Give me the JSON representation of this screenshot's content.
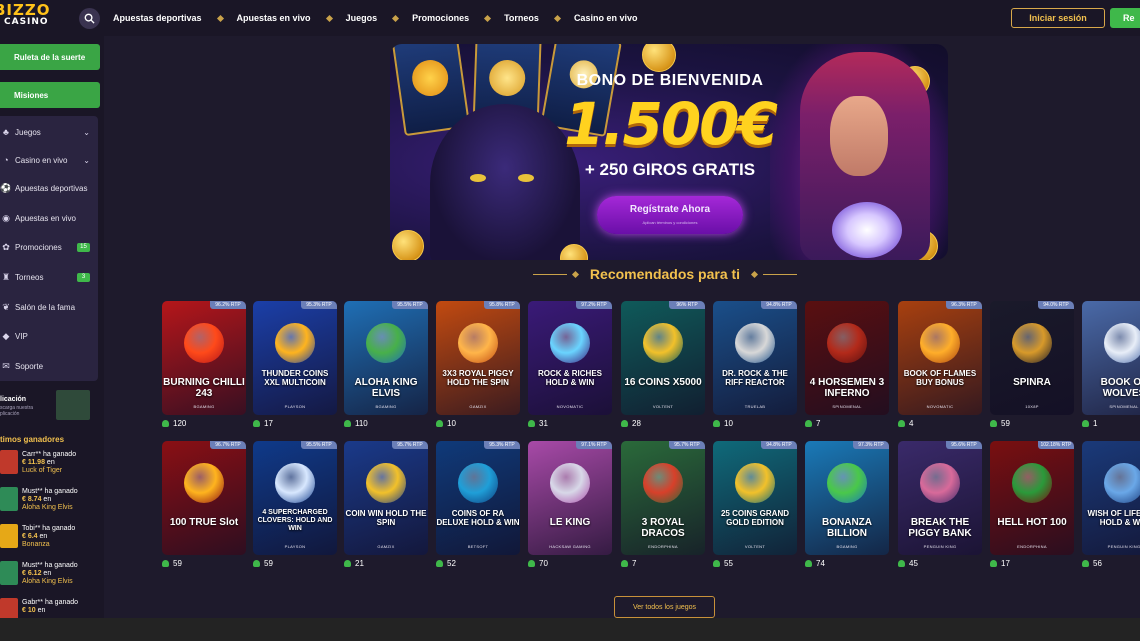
{
  "brand": {
    "line1": "BIZZO",
    "line2": "CASINO"
  },
  "nav": {
    "items": [
      "Apuestas deportivas",
      "Apuestas en vivo",
      "Juegos",
      "Promociones",
      "Torneos",
      "Casino en vivo"
    ]
  },
  "auth": {
    "login_label": "Iniciar sesión",
    "register_label": "Re"
  },
  "sidebar": {
    "promo_buttons": [
      "Ruleta de la suerte",
      "Misiones"
    ],
    "menu": [
      {
        "label": "Juegos",
        "icon": "cards-icon",
        "chevron": true
      },
      {
        "label": "Casino en vivo",
        "icon": "live-icon",
        "chevron": true
      },
      {
        "label": "Apuestas deportivas",
        "icon": "ball-icon"
      },
      {
        "label": "Apuestas en vivo",
        "icon": "live-bet-icon"
      },
      {
        "label": "Promociones",
        "icon": "gift-icon",
        "badge": "15"
      },
      {
        "label": "Torneos",
        "icon": "trophy-icon",
        "badge": "3"
      },
      {
        "label": "Salón de la fama",
        "icon": "laurel-icon"
      },
      {
        "label": "VIP",
        "icon": "diamond-icon"
      },
      {
        "label": "Soporte",
        "icon": "chat-icon"
      }
    ],
    "app": {
      "title": "licación",
      "subtitle": "scarga nuestra plicación"
    },
    "winners_title": "timos ganadores",
    "winners": [
      {
        "user": "Carr** ha ganado",
        "amount": "€ 11.98",
        "en": "en",
        "game": "Luck of Tiger",
        "color": "#c0392b"
      },
      {
        "user": "Must** ha ganado",
        "amount": "€ 8.74",
        "en": "en",
        "game": "Aloha King Elvis",
        "color": "#2e8b57"
      },
      {
        "user": "Tobi** ha ganado",
        "amount": "€ 6.4",
        "en": "en",
        "game": "Bonanza",
        "color": "#e6a817"
      },
      {
        "user": "Must** ha ganado",
        "amount": "€ 6.12",
        "en": "en",
        "game": "Aloha King Elvis",
        "color": "#2e8b57"
      },
      {
        "user": "Gabr** ha ganado",
        "amount": "€ 10",
        "en": "en",
        "game": "",
        "color": "#c0392b"
      }
    ]
  },
  "banner": {
    "title": "BONO DE BIENVENIDA",
    "amount": "1.500€",
    "spins": "+ 250 GIROS GRATIS",
    "cta": "Regístrate Ahora",
    "cta_sub": "Aplican términos y condiciones"
  },
  "section": {
    "title": "Recomendados para ti",
    "view_all": "Ver todos los juegos"
  },
  "games_row1": [
    {
      "name": "BURNING CHILLI 243",
      "prov": "BGAMING",
      "rtp": "96.2% RTP",
      "players": "120",
      "bg": "#b5161a",
      "art": "#ff4a1a"
    },
    {
      "name": "THUNDER COINS XXL MULTICOIN",
      "prov": "PLAYSON",
      "rtp": "95.3% RTP",
      "players": "17",
      "bg": "#1b3fa8",
      "art": "#ffb41e"
    },
    {
      "name": "ALOHA KING ELVIS",
      "prov": "BGAMING",
      "rtp": "95.5% RTP",
      "players": "110",
      "bg": "#1f6fb5",
      "art": "#48b04a"
    },
    {
      "name": "3X3 ROYAL PIGGY HOLD THE SPIN",
      "prov": "GAMZIX",
      "rtp": "95.8% RTP",
      "players": "10",
      "bg": "#c24a10",
      "art": "#ffb54a"
    },
    {
      "name": "ROCK & RICHES HOLD & WIN",
      "prov": "NOVOMATIC",
      "rtp": "97.2% RTP",
      "players": "31",
      "bg": "#3a1a78",
      "art": "#6ad4ff"
    },
    {
      "name": "16 COINS X5000",
      "prov": "VOLTENT",
      "rtp": "96% RTP",
      "players": "28",
      "bg": "#0f5a5a",
      "art": "#f2c12a"
    },
    {
      "name": "DR. ROCK & THE RIFF REACTOR",
      "prov": "TRUELAB",
      "rtp": "94.8% RTP",
      "players": "10",
      "bg": "#1a4f8a",
      "art": "#d8d8d8"
    },
    {
      "name": "4 HORSEMEN 3 INFERNO",
      "prov": "SPINOMENAL",
      "rtp": "",
      "players": "7",
      "bg": "#5a0f10",
      "art": "#b32a1a"
    },
    {
      "name": "BOOK OF FLAMES BUY BONUS",
      "prov": "NOVOMATIC",
      "rtp": "96.3% RTP",
      "players": "4",
      "bg": "#a8400f",
      "art": "#ffae2a"
    },
    {
      "name": "SPINRA",
      "prov": "10X8P",
      "rtp": "94.0% RTP",
      "players": "59",
      "bg": "#1a1a2a",
      "art": "#d89a2a"
    },
    {
      "name": "BOOK OF WOLVES",
      "prov": "SPINOMENAL",
      "rtp": "",
      "players": "1",
      "bg": "#4a6aa8",
      "art": "#e8eef8"
    }
  ],
  "games_row2": [
    {
      "name": "100 TRUE Slot",
      "prov": "",
      "rtp": "96.7% RTP",
      "players": "59",
      "bg": "#8a0f14",
      "art": "#ffb41e"
    },
    {
      "name": "4 SUPERCHARGED CLOVERS: HOLD AND WIN",
      "prov": "PLAYSON",
      "rtp": "95.5% RTP",
      "players": "59",
      "bg": "#0f3a8a",
      "art": "#d8e8ff"
    },
    {
      "name": "COIN WIN HOLD THE SPIN",
      "prov": "GAMZIX",
      "rtp": "95.7% RTP",
      "players": "21",
      "bg": "#1a3a8a",
      "art": "#f2c12a"
    },
    {
      "name": "COINS OF RA DELUXE HOLD & WIN",
      "prov": "BETSOFT",
      "rtp": "95.3% RTP",
      "players": "52",
      "bg": "#0f3a7a",
      "art": "#1f9fd8"
    },
    {
      "name": "LE KING",
      "prov": "HACKSAW GAMING",
      "rtp": "97.1% RTP",
      "players": "70",
      "bg": "#a84aa8",
      "art": "#d8d8e8"
    },
    {
      "name": "3 ROYAL DRACOS",
      "prov": "ENDORPHINA",
      "rtp": "95.7% RTP",
      "players": "7",
      "bg": "#2a6a3a",
      "art": "#d8402a"
    },
    {
      "name": "25 COINS GRAND GOLD EDITION",
      "prov": "VOLTENT",
      "rtp": "94.8% RTP",
      "players": "55",
      "bg": "#0f6a7a",
      "art": "#f2c12a"
    },
    {
      "name": "BONANZA BILLION",
      "prov": "BGAMING",
      "rtp": "97.3% RTP",
      "players": "74",
      "bg": "#1a7ab8",
      "art": "#4ac84a"
    },
    {
      "name": "BREAK THE PIGGY BANK",
      "prov": "PENGUIN KING",
      "rtp": "95.6% RTP",
      "players": "45",
      "bg": "#3a2a6a",
      "art": "#d86a9a"
    },
    {
      "name": "HELL HOT 100",
      "prov": "ENDORPHINA",
      "rtp": "102.18% RTP",
      "players": "17",
      "bg": "#7a0f10",
      "art": "#2a9a3a"
    },
    {
      "name": "WISH OF LIFETIME HOLD & WIN",
      "prov": "PENGUIN KING",
      "rtp": "",
      "players": "56",
      "bg": "#1a3a7a",
      "art": "#6aa8e8"
    }
  ]
}
